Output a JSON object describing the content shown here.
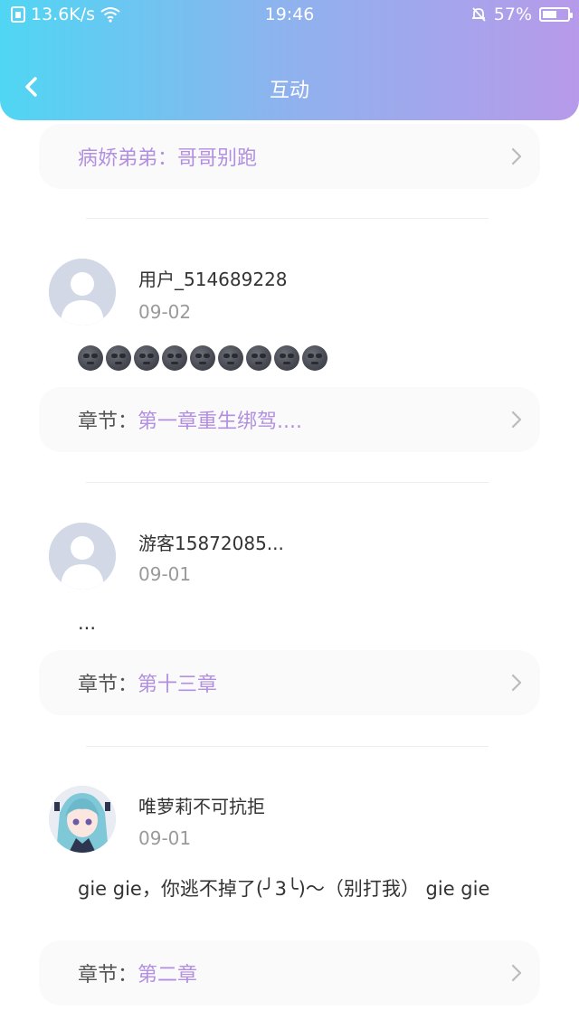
{
  "status_bar": {
    "network_speed": "13.6K/s",
    "time": "19:46",
    "battery_percent": "57%",
    "battery_level": 0.57
  },
  "nav": {
    "title": "互动"
  },
  "top_card": {
    "value": "病娇弟弟：哥哥别跑"
  },
  "comments": [
    {
      "username": "用户_514689228",
      "date": "09-02",
      "text": "",
      "emoji_count": 9,
      "chapter_label": "章节：",
      "chapter_value": "第一章重生绑驾...."
    },
    {
      "username": "游客15872085...",
      "date": "09-01",
      "text": "...",
      "chapter_label": "章节：",
      "chapter_value": "第十三章"
    },
    {
      "username": "唯萝莉不可抗拒",
      "date": "09-01",
      "text": "gie gie，你逃不掉了(╯3╰)～（别打我） gie gie",
      "chapter_label": "章节：",
      "chapter_value": "第二章"
    }
  ]
}
